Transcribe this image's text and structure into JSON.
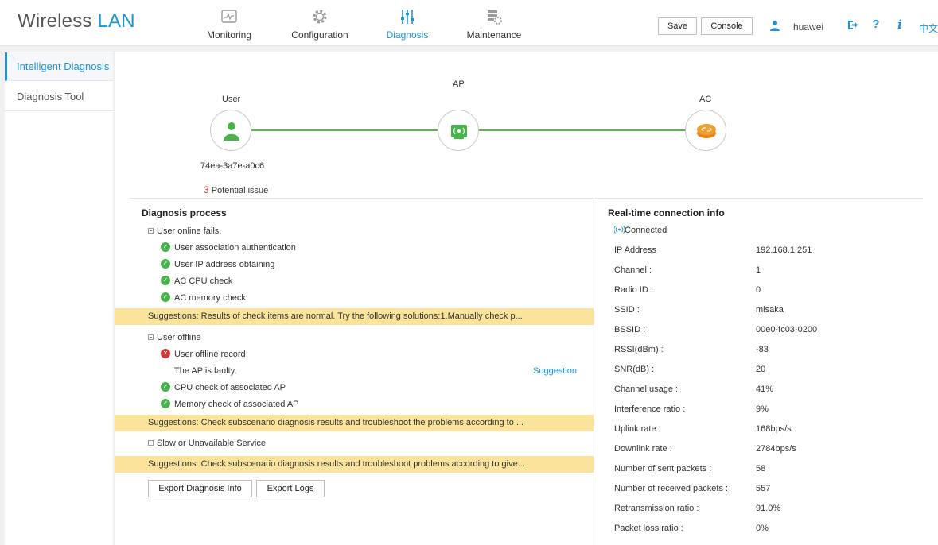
{
  "header": {
    "brand_primary": "Wireless",
    "brand_accent": "LAN",
    "nav": [
      {
        "label": "Monitoring",
        "icon": "monitor-icon"
      },
      {
        "label": "Configuration",
        "icon": "gear-icon"
      },
      {
        "label": "Diagnosis",
        "icon": "sliders-icon",
        "active": true
      },
      {
        "label": "Maintenance",
        "icon": "tools-icon"
      }
    ],
    "save_label": "Save",
    "console_label": "Console",
    "username": "huawei",
    "help_glyph": "?",
    "info_glyph": "i",
    "language": "中文"
  },
  "sidebar": {
    "items": [
      {
        "label": "Intelligent Diagnosis",
        "active": true
      },
      {
        "label": "Diagnosis Tool"
      }
    ]
  },
  "topology": {
    "user_label": "User",
    "ap_label": "AP",
    "ac_label": "AC",
    "mac": "74ea-3a7e-a0c6",
    "issue_count": "3",
    "issue_text": "Potential issue"
  },
  "diagnosis": {
    "title": "Diagnosis process",
    "group1": {
      "title": "User online fails.",
      "checks": [
        "User association authentication",
        "User IP address obtaining",
        "AC CPU check",
        "AC memory check"
      ],
      "suggestion": "Suggestions: Results of check items are normal. Try the following solutions:1.Manually check p..."
    },
    "group2": {
      "title": "User offline",
      "error_item": "User offline record",
      "error_detail": "The AP is faulty.",
      "suggestion_link": "Suggestion",
      "checks": [
        "CPU check of associated AP",
        "Memory check of associated AP"
      ],
      "suggestion": "Suggestions: Check subscenario diagnosis results and troubleshoot the problems according to ..."
    },
    "group3": {
      "title": "Slow or Unavailable Service",
      "suggestion": "Suggestions: Check subscenario diagnosis results and troubleshoot problems according to give..."
    },
    "export_info_label": "Export Diagnosis Info",
    "export_logs_label": "Export Logs"
  },
  "realtime": {
    "title": "Real-time connection info",
    "status": "Connected",
    "fields": [
      {
        "label": "IP Address :",
        "value": "192.168.1.251"
      },
      {
        "label": "Channel :",
        "value": "1"
      },
      {
        "label": "Radio ID :",
        "value": "0"
      },
      {
        "label": "SSID :",
        "value": "misaka"
      },
      {
        "label": "BSSID :",
        "value": "00e0-fc03-0200"
      },
      {
        "label": "RSSI(dBm) :",
        "value": "-83"
      },
      {
        "label": "SNR(dB) :",
        "value": "20"
      },
      {
        "label": "Channel usage :",
        "value": "41%"
      },
      {
        "label": "Interference ratio :",
        "value": "9%"
      },
      {
        "label": "Uplink rate :",
        "value": "168bps/s"
      },
      {
        "label": "Downlink rate :",
        "value": "2784bps/s"
      },
      {
        "label": "Number of sent packets :",
        "value": "58"
      },
      {
        "label": "Number of received packets :",
        "value": "557"
      },
      {
        "label": "Retransmission ratio :",
        "value": "91.0%"
      },
      {
        "label": "Packet loss ratio :",
        "value": "0%"
      }
    ]
  },
  "colors": {
    "accent": "#1a95d6",
    "ok": "#48b34a",
    "error": "#d8342c",
    "suggestion_bg": "#fbe39b",
    "ac_node": "#f0a030"
  }
}
